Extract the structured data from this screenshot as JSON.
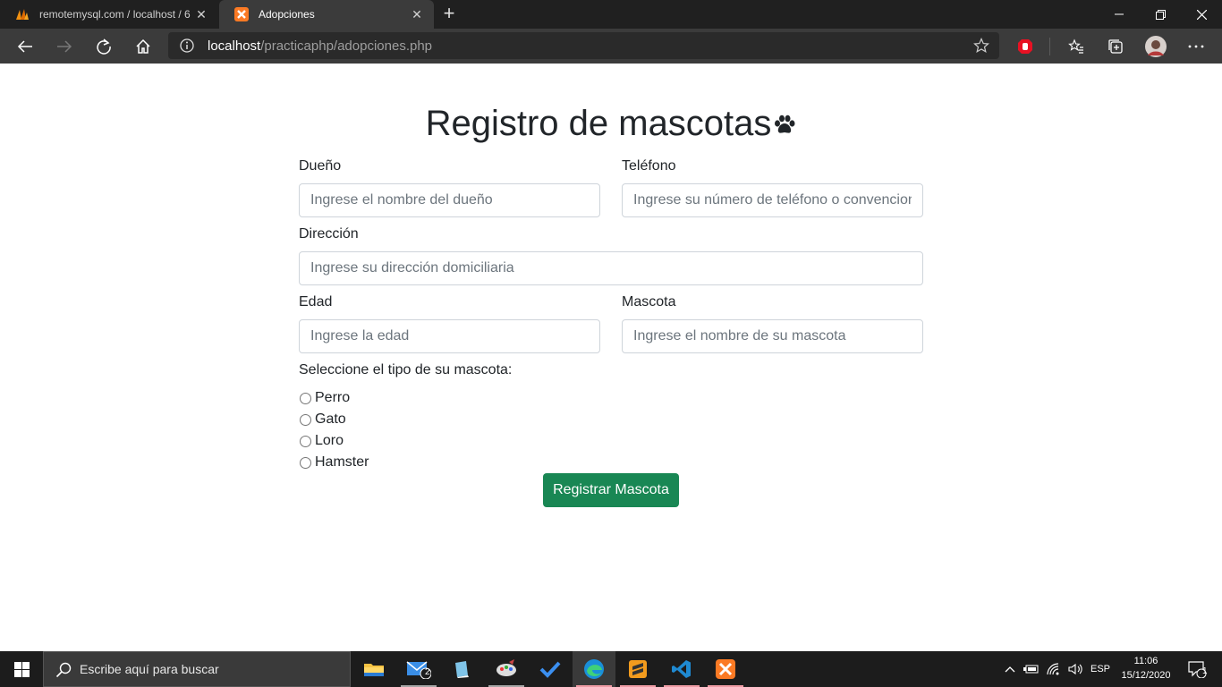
{
  "browser": {
    "tabs": [
      {
        "title": "remotemysql.com / localhost / 6",
        "active": false
      },
      {
        "title": "Adopciones",
        "active": true
      }
    ],
    "address": {
      "host": "localhost",
      "path": "/practicaphp/adopciones.php"
    }
  },
  "form": {
    "title": "Registro de mascotas",
    "owner": {
      "label": "Dueño",
      "placeholder": "Ingrese el nombre del dueño"
    },
    "phone": {
      "label": "Teléfono",
      "placeholder": "Ingrese su número de teléfono o convencional"
    },
    "address": {
      "label": "Dirección",
      "placeholder": "Ingrese su dirección domiciliaria"
    },
    "age": {
      "label": "Edad",
      "placeholder": "Ingrese la edad"
    },
    "pet": {
      "label": "Mascota",
      "placeholder": "Ingrese el nombre de su mascota"
    },
    "pet_type_label": "Seleccione el tipo de su mascota:",
    "pet_types": [
      "Perro",
      "Gato",
      "Loro",
      "Hamster"
    ],
    "submit_label": "Registrar Mascota"
  },
  "taskbar": {
    "search_placeholder": "Escribe aquí para buscar",
    "mail_badge": "2",
    "language": "ESP",
    "time": "11:06",
    "date": "15/12/2020",
    "notifications": "1"
  },
  "colors": {
    "submit": "#198754",
    "chrome_dark": "#202020",
    "toolbar": "#3b3b3b"
  }
}
